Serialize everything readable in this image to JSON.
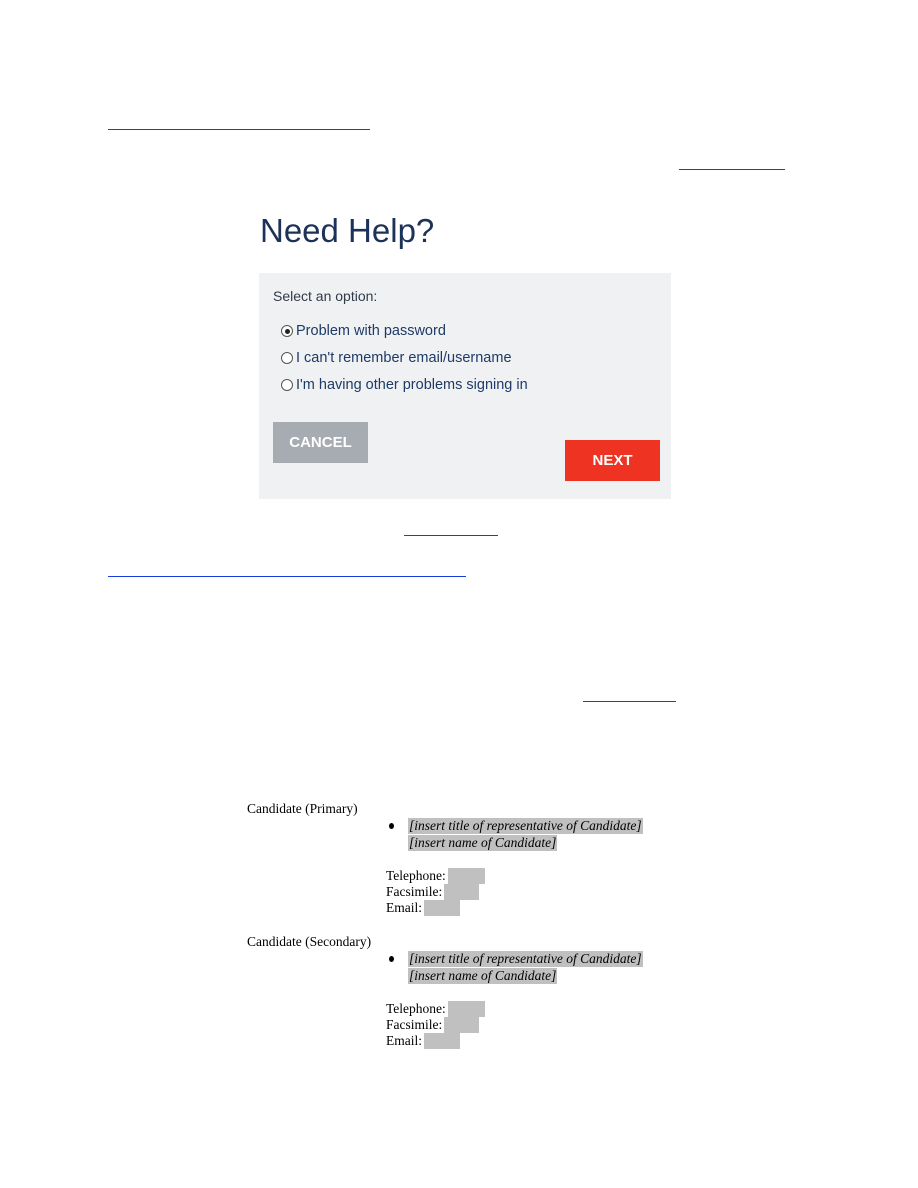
{
  "dialog": {
    "title": "Need Help?",
    "prompt": "Select an option:",
    "options": [
      {
        "label": "Problem with password",
        "checked": true
      },
      {
        "label": "I can't remember email/username",
        "checked": false
      },
      {
        "label": "I'm having other problems signing in",
        "checked": false
      }
    ],
    "cancel_label": "CANCEL",
    "next_label": "NEXT",
    "colors": {
      "title": "#1c3258",
      "panel": "#f0f1f2",
      "cancel": "#a7acb3",
      "next": "#ee3322",
      "link": "#1a3edc"
    }
  },
  "contacts": [
    {
      "label": "Candidate (Primary)",
      "title_placeholder": "[insert title of representative of Candidate]",
      "name_placeholder": "[insert name of Candidate]",
      "telephone_label": "Telephone:",
      "facsimile_label": "Facsimile:",
      "email_label": "Email:"
    },
    {
      "label": "Candidate (Secondary)",
      "title_placeholder": "[insert title of representative of Candidate]",
      "name_placeholder": "[insert name of Candidate]",
      "telephone_label": "Telephone:",
      "facsimile_label": "Facsimile:",
      "email_label": "Email:"
    }
  ]
}
